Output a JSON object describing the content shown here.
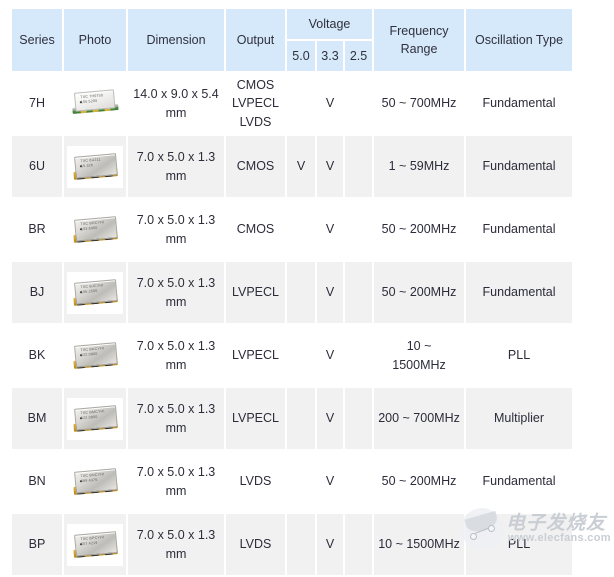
{
  "table": {
    "headers": {
      "series": "Series",
      "photo": "Photo",
      "dimension": "Dimension",
      "output": "Output",
      "voltage_group": "Voltage",
      "voltage_5_0": "5.0",
      "voltage_3_3": "3.3",
      "voltage_2_5": "2.5",
      "frequency_range": "Frequency Range",
      "oscillation_type": "Oscillation Type"
    },
    "check_mark": "V",
    "colors": {
      "header_bg": "#d6e9fa",
      "row_odd_bg": "#ffffff",
      "row_even_bg": "#f1f1f1",
      "text": "#2c2c3a",
      "check_mark": "#4a4a8a"
    },
    "rows": [
      {
        "series": "7H",
        "photo_alt": "oscillator-package-photo",
        "photo_style": "hybrid",
        "photo_marking_line1": "TXC 7H0750",
        "photo_marking_line2": "155.5200",
        "dimension": [
          "14.0 x 9.0 x 5.4",
          "mm"
        ],
        "output": [
          "CMOS",
          "LVPECL",
          "LVDS"
        ],
        "v5_0": "",
        "v3_3": "V",
        "v2_5": "",
        "frequency_range": [
          "50 ~ 700MHz"
        ],
        "oscillation_type": "Fundamental"
      },
      {
        "series": "6U",
        "photo_alt": "oscillator-package-photo",
        "photo_style": "smd",
        "photo_marking_line1": "TXC 6U211",
        "photo_marking_line2": "15.326",
        "dimension": [
          "7.0 x 5.0 x 1.3",
          "mm"
        ],
        "output": [
          "CMOS"
        ],
        "v5_0": "V",
        "v3_3": "V",
        "v2_5": "",
        "frequency_range": [
          "1 ~ 59MHz"
        ],
        "oscillation_type": "Fundamental"
      },
      {
        "series": "BR",
        "photo_alt": "oscillator-package-photo",
        "photo_style": "smd",
        "photo_marking_line1": "TXC BRCYHI",
        "photo_marking_line2": "153.6000",
        "dimension": [
          "7.0 x 5.0 x 1.3",
          "mm"
        ],
        "output": [
          "CMOS"
        ],
        "v5_0": "",
        "v3_3": "V",
        "v2_5": "",
        "frequency_range": [
          "50 ~ 200MHz"
        ],
        "oscillation_type": "Fundamental"
      },
      {
        "series": "BJ",
        "photo_alt": "oscillator-package-photo",
        "photo_style": "smd",
        "photo_marking_line1": "TXC BJCYHI",
        "photo_marking_line2": "156.2500",
        "dimension": [
          "7.0 x 5.0 x 1.3",
          "mm"
        ],
        "output": [
          "LVPECL"
        ],
        "v5_0": "",
        "v3_3": "V",
        "v2_5": "",
        "frequency_range": [
          "50 ~ 200MHz"
        ],
        "oscillation_type": "Fundamental"
      },
      {
        "series": "BK",
        "photo_alt": "oscillator-package-photo",
        "photo_style": "smd",
        "photo_marking_line1": "TXC BKCYHI",
        "photo_marking_line2": "622.0800",
        "dimension": [
          "7.0 x 5.0 x 1.3",
          "mm"
        ],
        "output": [
          "LVPECL"
        ],
        "v5_0": "",
        "v3_3": "V",
        "v2_5": "",
        "frequency_range": [
          "10 ~",
          "1500MHz"
        ],
        "oscillation_type": "PLL"
      },
      {
        "series": "BM",
        "photo_alt": "oscillator-package-photo",
        "photo_style": "smd",
        "photo_marking_line1": "TXC BMCYHI",
        "photo_marking_line2": "622.0800",
        "dimension": [
          "7.0 x 5.0 x 1.3",
          "mm"
        ],
        "output": [
          "LVPECL"
        ],
        "v5_0": "",
        "v3_3": "V",
        "v2_5": "",
        "frequency_range": [
          "200 ~ 700MHz"
        ],
        "oscillation_type": "Multiplier"
      },
      {
        "series": "BN",
        "photo_alt": "oscillator-package-photo",
        "photo_style": "smd",
        "photo_marking_line1": "TXC BNCYHI",
        "photo_marking_line2": "669.4375",
        "dimension": [
          "7.0 x 5.0 x 1.3",
          "mm"
        ],
        "output": [
          "LVDS"
        ],
        "v5_0": "",
        "v3_3": "V",
        "v2_5": "",
        "frequency_range": [
          "50 ~ 200MHz"
        ],
        "oscillation_type": "Fundamental"
      },
      {
        "series": "BP",
        "photo_alt": "oscillator-package-photo",
        "photo_style": "smd",
        "photo_marking_line1": "TXC BPCYHI",
        "photo_marking_line2": "557.4219",
        "dimension": [
          "7.0 x 5.0 x 1.3",
          "mm"
        ],
        "output": [
          "LVDS"
        ],
        "v5_0": "",
        "v3_3": "V",
        "v2_5": "",
        "frequency_range": [
          "10 ~ 1500MHz"
        ],
        "oscillation_type": "PLL"
      }
    ]
  },
  "watermark": {
    "chinese_text": "电子发烧友",
    "url_text": "www.elecfans.com"
  }
}
